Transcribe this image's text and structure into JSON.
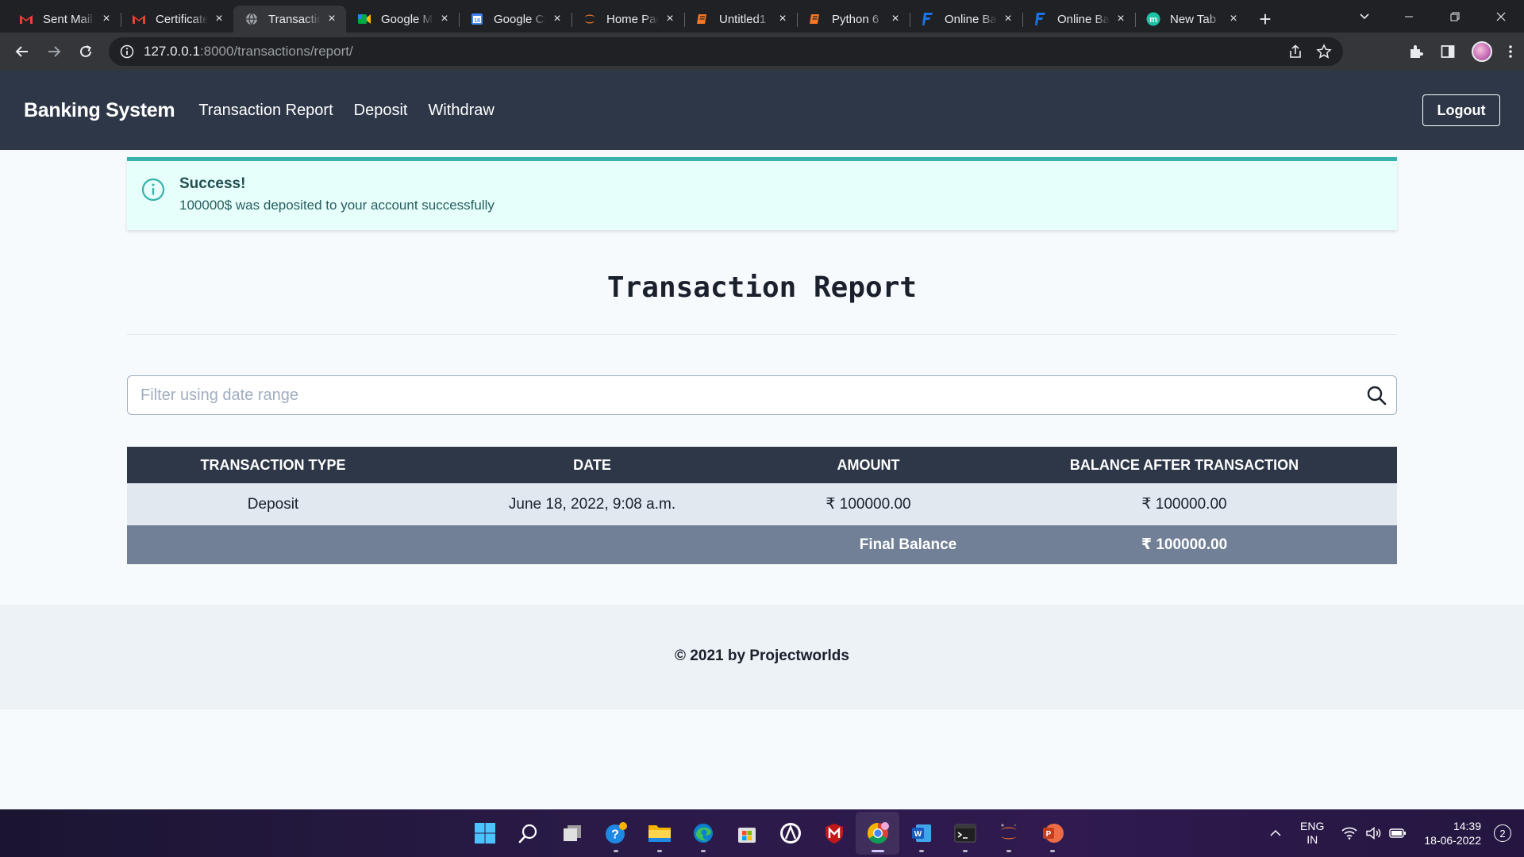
{
  "browser": {
    "tabs": [
      {
        "title": "Sent Mail",
        "icon": "gmail-icon"
      },
      {
        "title": "Certificate",
        "icon": "gmail-icon"
      },
      {
        "title": "Transaction",
        "icon": "globe-icon",
        "active": true
      },
      {
        "title": "Google Meet",
        "icon": "google-meet-icon"
      },
      {
        "title": "Google Calendar",
        "icon": "google-calendar-icon"
      },
      {
        "title": "Home Page",
        "icon": "jupyter-icon"
      },
      {
        "title": "Untitled1",
        "icon": "notebook-icon"
      },
      {
        "title": "Python 6",
        "icon": "notebook-icon"
      },
      {
        "title": "Online Banking",
        "icon": "bank-logo-icon"
      },
      {
        "title": "Online Banking",
        "icon": "bank-logo-icon"
      },
      {
        "title": "New Tab",
        "icon": "new-tab-icon"
      }
    ],
    "url_host": "127.0.0.1",
    "url_path": ":8000/transactions/report/"
  },
  "nav": {
    "brand": "Banking System",
    "links": [
      "Transaction Report",
      "Deposit",
      "Withdraw"
    ],
    "logout": "Logout"
  },
  "alert": {
    "title": "Success!",
    "message": "100000$ was deposited to your account successfully"
  },
  "report": {
    "title": "Transaction Report",
    "filter_placeholder": "Filter using date range",
    "columns": [
      "Transaction Type",
      "Date",
      "Amount",
      "Balance After Transaction"
    ],
    "rows": [
      {
        "type": "Deposit",
        "date": "June 18, 2022, 9:08 a.m.",
        "amount": "₹ 100000.00",
        "balance": "₹ 100000.00"
      }
    ],
    "final_label": "Final Balance",
    "final_value": "₹ 100000.00"
  },
  "footer": {
    "text": "© 2021 by Projectworlds"
  },
  "taskbar": {
    "apps": [
      "windows-start-icon",
      "search-icon",
      "task-view-icon",
      "help-icon",
      "file-explorer-icon",
      "edge-icon",
      "store-icon",
      "app-circle-icon",
      "mcafee-icon",
      "chrome-icon",
      "word-icon",
      "terminal-icon",
      "jupyter-icon",
      "powerpoint-icon"
    ],
    "lang_top": "ENG",
    "lang_bottom": "IN",
    "time": "14:39",
    "date": "18-06-2022",
    "notifications": "2"
  }
}
